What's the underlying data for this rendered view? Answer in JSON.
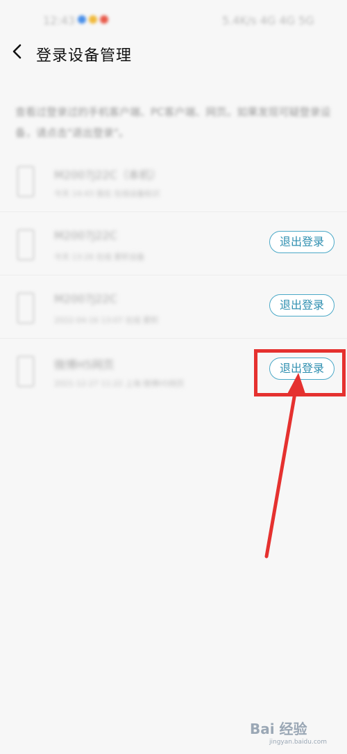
{
  "status_bar": {
    "time": "12:43",
    "right_text": "5.4K/s 4G 4G 5G",
    "dot_colors": [
      "#4a8fe8",
      "#f0b93a",
      "#e85a4a"
    ]
  },
  "header": {
    "title": "登录设备管理"
  },
  "description": "查看过登录过的手机客户端、PC客户端、网页。如果发现可疑登录设备，请点击\"退出登录\"。",
  "devices": [
    {
      "name": "M2007J22C（本机）",
      "info": "今天 14:43  我在  在线设备标识",
      "has_logout": false
    },
    {
      "name": "M2007J22C",
      "info": "今天 13:26  在线  累积设备",
      "has_logout": true,
      "logout_label": "退出登录"
    },
    {
      "name": "M2007J22C",
      "info": "2022-04-16 13:07  在线  累积",
      "has_logout": true,
      "logout_label": "退出登录"
    },
    {
      "name": "微博H5网页",
      "info": "2021-12-27 11:22  上海  微博H5网页",
      "has_logout": true,
      "logout_label": "退出登录"
    }
  ],
  "annotation": {
    "highlight_color": "#e5312f"
  },
  "watermark": {
    "logo": "Bai 经验",
    "sub": "jingyan.baidu.com"
  }
}
